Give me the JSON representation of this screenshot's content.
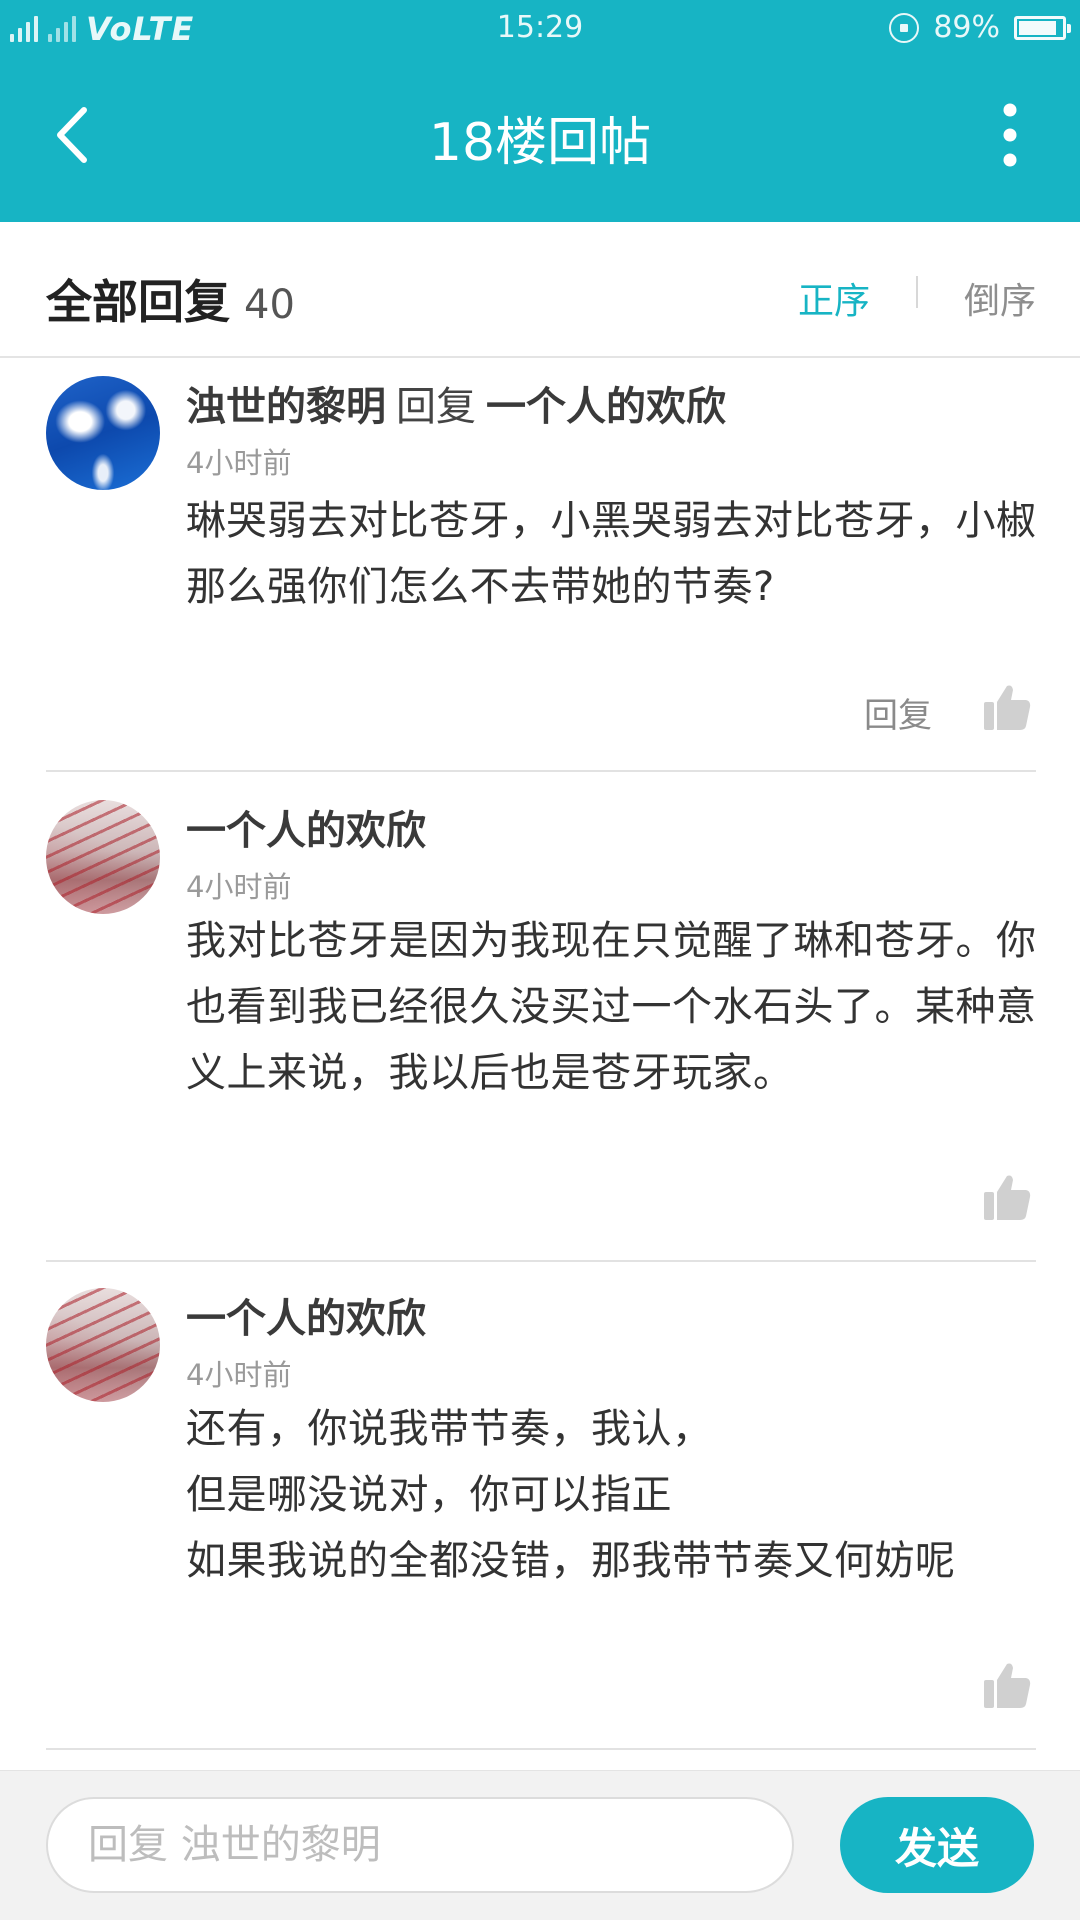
{
  "status_bar": {
    "network_left": "4G",
    "network_label": "VoLTE",
    "time": "15:29",
    "battery_percent_text": "89%",
    "battery_level": 0.89
  },
  "nav": {
    "title": "18楼回帖",
    "back_icon": "chevron-left-icon",
    "more_icon": "more-vertical-icon"
  },
  "header": {
    "title": "全部回复",
    "count": "40",
    "sort_asc": "正序",
    "sort_desc": "倒序"
  },
  "comments": [
    {
      "author": "浊世的黎明",
      "reply_word": "回复",
      "reply_to": "一个人的欢欣",
      "time": "4小时前",
      "text": "琳哭弱去对比苍牙，小黑哭弱去对比苍牙，小椒那么强你们怎么不去带她的节奏?",
      "reply_label": "回复"
    },
    {
      "author": "一个人的欢欣",
      "time": "4小时前",
      "text": "我对比苍牙是因为我现在只觉醒了琳和苍牙。你也看到我已经很久没买过一个水石头了。某种意义上来说，我以后也是苍牙玩家。"
    },
    {
      "author": "一个人的欢欣",
      "time": "4小时前",
      "text_lines": [
        "还有，你说我带节奏，我认，",
        "但是哪没说对，你可以指正",
        "如果我说的全都没错，那我带节奏又何妨呢"
      ]
    }
  ],
  "input_bar": {
    "placeholder": "回复 浊世的黎明",
    "value": "",
    "send_label": "发送"
  },
  "colors": {
    "accent": "#17b4c4",
    "divider": "#e2e2e2"
  }
}
